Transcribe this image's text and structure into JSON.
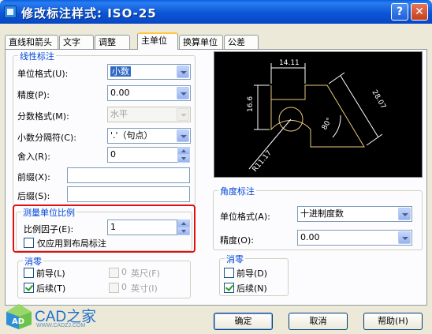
{
  "window": {
    "title": "修改标注样式: ISO-25",
    "help_glyph": "?",
    "close_glyph": "✕"
  },
  "tabs": [
    "直线和箭头",
    "文字",
    "调整",
    "主单位",
    "换算单位",
    "公差"
  ],
  "linear": {
    "title": "线性标注",
    "unit_format_label": "单位格式(U):",
    "unit_format_value": "小数",
    "precision_label": "精度(P):",
    "precision_value": "0.00",
    "fraction_format_label": "分数格式(M):",
    "fraction_format_value": "水平",
    "decimal_sep_label": "小数分隔符(C):",
    "decimal_sep_value": "'.'（句点）",
    "round_label": "舍入(R):",
    "round_value": "0",
    "prefix_label": "前缀(X):",
    "prefix_value": "",
    "suffix_label": "后缀(S):",
    "suffix_value": ""
  },
  "scale": {
    "title": "测量单位比例",
    "factor_label": "比例因子(E):",
    "factor_value": "1",
    "layout_only_label": "仅应用到布局标注"
  },
  "zero_left": {
    "title": "消零",
    "leading_label": "前导(L)",
    "trailing_label": "后续(T)",
    "feet_value": "0",
    "feet_label": "英尺(F)",
    "inch_value": "0",
    "inch_label": "英寸(I)",
    "leading_checked": false,
    "trailing_checked": true
  },
  "preview": {
    "dim_top": "14.11",
    "dim_left": "16.6",
    "dim_right": "28.07",
    "dim_angle": "80°",
    "dim_radius": "R11.17"
  },
  "angle": {
    "title": "角度标注",
    "unit_format_label": "单位格式(A):",
    "unit_format_value": "十进制度数",
    "precision_label": "精度(O):",
    "precision_value": "0.00"
  },
  "zero_right": {
    "title": "消零",
    "leading_label": "前导(D)",
    "trailing_label": "后续(N)",
    "leading_checked": false,
    "trailing_checked": true
  },
  "buttons": {
    "ok": "确定",
    "cancel": "取消",
    "help": "帮助(H)"
  },
  "logo": {
    "text": "CAD之家",
    "url": "WWW.CADZJ.COM"
  },
  "colors": {
    "accent": "#0046d5",
    "highlight_box": "#e01010",
    "preview_bg": "#000000",
    "geometry": "#e8c878"
  }
}
